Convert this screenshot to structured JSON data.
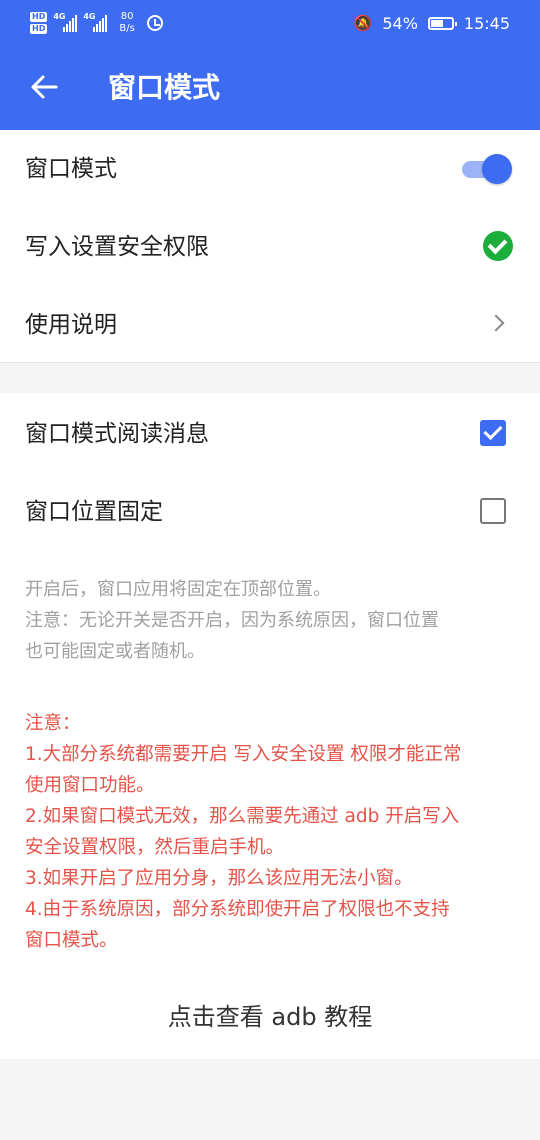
{
  "status_bar": {
    "hd1": "HD",
    "hd2": "HD",
    "net1": "4G",
    "net2": "4G",
    "speed_value": "80",
    "speed_unit": "B/s",
    "battery_percent": "54%",
    "battery_level": 0.54,
    "time": "15:45",
    "icons": [
      "signal-icon",
      "alarm-icon",
      "mute-bell-icon",
      "battery-icon"
    ]
  },
  "app_bar": {
    "title": "窗口模式",
    "back_icon": "arrow-left-icon"
  },
  "settings": {
    "window_mode": {
      "label": "窗口模式",
      "enabled": true
    },
    "write_permission": {
      "label": "写入设置安全权限",
      "granted": true
    },
    "instructions": {
      "label": "使用说明"
    }
  },
  "options": {
    "read_messages": {
      "label": "窗口模式阅读消息",
      "checked": true
    },
    "fixed_position": {
      "label": "窗口位置固定",
      "checked": false
    }
  },
  "hint_lines": [
    "开启后，窗口应用将固定在顶部位置。",
    "注意：无论开关是否开启，因为系统原因，窗口位置",
    "也可能固定或者随机。"
  ],
  "warning_lines": [
    "注意：",
    "1.大部分系统都需要开启 写入安全设置 权限才能正常",
    "使用窗口功能。",
    "2.如果窗口模式无效，那么需要先通过 adb 开启写入",
    "安全设置权限，然后重启手机。",
    "3.如果开启了应用分身，那么该应用无法小窗。",
    "4.由于系统原因，部分系统即使开启了权限也不支持",
    "窗口模式。"
  ],
  "tutorial_link": "点击查看 adb 教程",
  "colors": {
    "primary": "#3d6cf2",
    "success": "#1cad3a",
    "warning_text": "#e5544a",
    "hint_text": "#a0a0a0",
    "background": "#f5f5f5"
  }
}
